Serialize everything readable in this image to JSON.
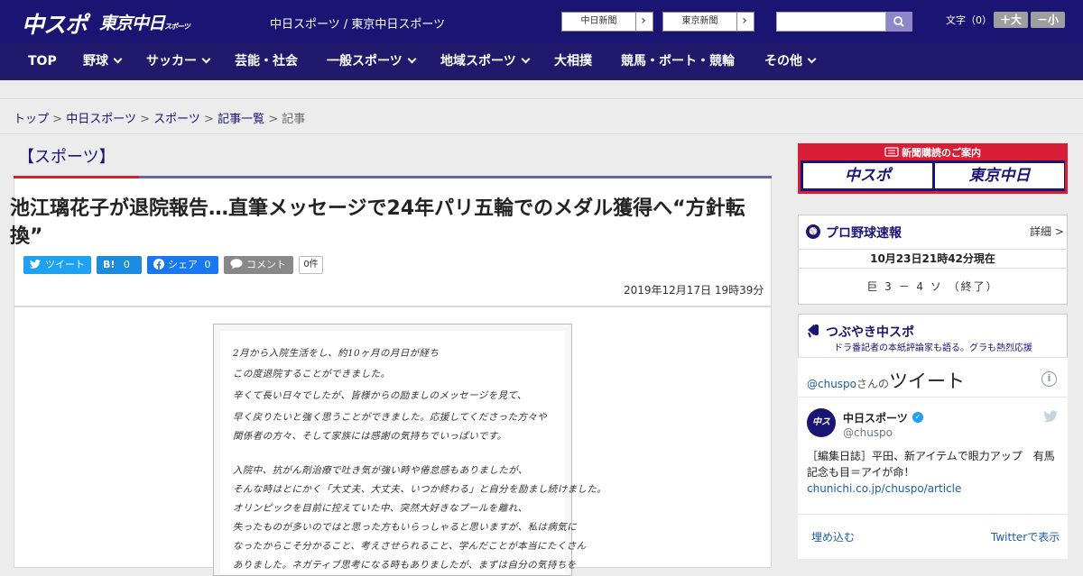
{
  "header": {
    "logo_chuspo": "中スポ",
    "logo_tokyo": "東京中日",
    "logo_tokyo_suffix": "スポーツ",
    "site_title": "中日スポーツ / 東京中日スポーツ",
    "ext_links": [
      {
        "label": "中日新聞",
        "arrow": "›"
      },
      {
        "label": "東京新聞",
        "arrow": "›"
      }
    ],
    "search_placeholder": "",
    "font_size_label": "文字（0）",
    "font_up": "＋大",
    "font_down": "－小"
  },
  "nav": {
    "items": [
      {
        "label": "TOP"
      },
      {
        "label": "野球"
      },
      {
        "label": "サッカー"
      },
      {
        "label": "芸能・社会"
      },
      {
        "label": "一般スポーツ"
      },
      {
        "label": "地域スポーツ"
      },
      {
        "label": "大相撲"
      },
      {
        "label": "競馬・ボート・競輪"
      },
      {
        "label": "その他"
      }
    ]
  },
  "breadcrumb": {
    "items": [
      "トップ",
      "中日スポーツ",
      "スポーツ",
      "記事一覧"
    ],
    "current": "記事",
    "sep": ">"
  },
  "article": {
    "category": "【スポーツ】",
    "headline": "池江璃花子が退院報告…直筆メッセージで24年パリ五輪でのメダル獲得へ“方針転換”",
    "share": {
      "tweet": "ツイート",
      "hatena": "B!",
      "hatena_count": "0",
      "facebook": "シェア",
      "facebook_count": "0",
      "comment": "コメント",
      "comment_count": "0件"
    },
    "date": "2019年12月17日 19時39分",
    "handwritten_lines": [
      "2月から入院生活をし、約10ヶ月の月日が経ち",
      "この度退院することができました。",
      "辛くて長い日々でしたが、皆様からの励ましのメッセージを見て、",
      "早く戻りたいと強く思うことができました。応援してくださった方々や",
      "関係者の方々、そして家族には感謝の気持ちでいっぱいです。",
      "入院中、抗がん剤治療で吐き気が強い時や倦怠感もありましたが、",
      "そんな時はとにかく「大丈夫、大丈夫、いつか終わる」と自分を励まし続けました。",
      "オリンピックを目前に控えていた中、突然大好きなプールを離れ、",
      "失ったものが多いのではと思った方もいらっしゃると思いますが、私は病気に",
      "なったからこそ分かること、考えさせられること、学んだことが本当にたくさん",
      "ありました。ネガティブ思考になる時もありましたが、まずは自分の気持ちを"
    ]
  },
  "sidebar": {
    "subscribe_title": "新聞購読のご案内",
    "subscribe_logo1": "中スポ",
    "subscribe_logo2": "東京中日",
    "baseball": {
      "title": "プロ野球速報",
      "detail": "詳細 >",
      "time": "10月23日21時42分現在",
      "score": "巨 3 － 4 ソ （終了）"
    },
    "tweets": {
      "title": "つぶやき中スポ",
      "subtitle": "ドラ番記者の本紙評論家も語る。グラも熱烈応援",
      "handle_prefix": "@chuspo",
      "handle_mid": "さんの",
      "handle_suffix": "ツイート",
      "info": "i",
      "account_name": "中日スポーツ",
      "account_handle": "@chuspo",
      "tweet_text": "［編集日誌］平田、新アイテムで眼力アップ　有馬記念も目＝アイが命！",
      "tweet_link": "chunichi.co.jp/chuspo/article",
      "tweet_more": "…",
      "embed": "埋め込む",
      "view": "Twitterで表示"
    }
  },
  "colors": {
    "brand_navy": "#1a1473",
    "accent_red": "#d81e36",
    "twitter_blue": "#1da1f2"
  }
}
